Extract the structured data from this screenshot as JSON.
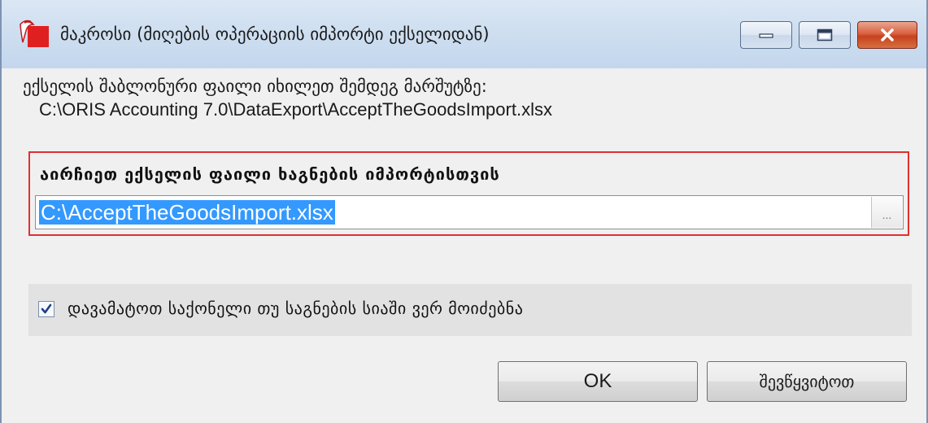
{
  "window": {
    "title": "მაკროსი (მიღების ოპერაციის იმპორტი ექსელიდან)",
    "icon": "oris-app-icon",
    "controls": [
      "minimize-icon",
      "maximize-icon",
      "close-icon"
    ]
  },
  "info": {
    "line1": "ექსელის შაბლონური ფაილი იხილეთ შემდეგ მარშუტზე:",
    "line2": "C:\\ORIS Accounting 7.0\\DataExport\\AcceptTheGoodsImport.xlsx"
  },
  "file_group": {
    "label": "აირჩიეთ ექსელის ფაილი ხაგნების იმპორტისთვის",
    "path_value": "C:\\AcceptTheGoodsImport.xlsx",
    "browse_label": "..."
  },
  "option": {
    "label": "დავამატოთ საქონელი თუ საგნების სიაში ვერ მოიძებნა",
    "checked": true
  },
  "buttons": {
    "ok": "OK",
    "cancel": "შევწყვიტოთ"
  },
  "colors": {
    "selection": "#3399ff",
    "group_border": "#e03030",
    "close_button": "#c7411f"
  }
}
